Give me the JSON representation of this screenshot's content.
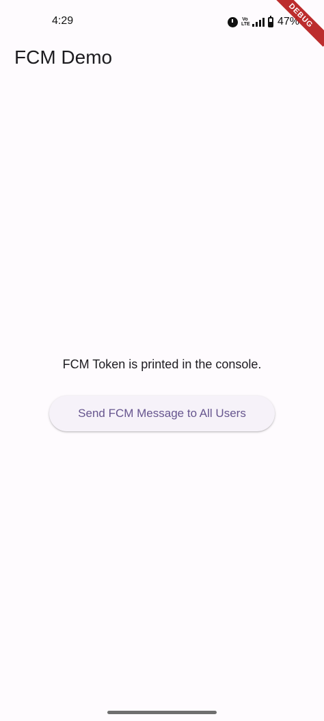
{
  "status_bar": {
    "time": "4:29",
    "volte_label": "Vo LTE",
    "signal_levels": 4,
    "battery_percent": 47,
    "battery_text": "47%",
    "icons": [
      "alarm-icon",
      "volte-icon",
      "signal-icon",
      "battery-icon"
    ]
  },
  "debug_banner": {
    "label": "DEBUG",
    "color": "#b71c1c"
  },
  "app_bar": {
    "title": "FCM Demo"
  },
  "main": {
    "info_text": "FCM Token is printed in the console.",
    "send_button_label": "Send FCM Message to All Users"
  },
  "colors": {
    "background": "#fefbfe",
    "button_text": "#66558e",
    "button_background": "#f6f2f9",
    "text": "#1c1b1f"
  }
}
